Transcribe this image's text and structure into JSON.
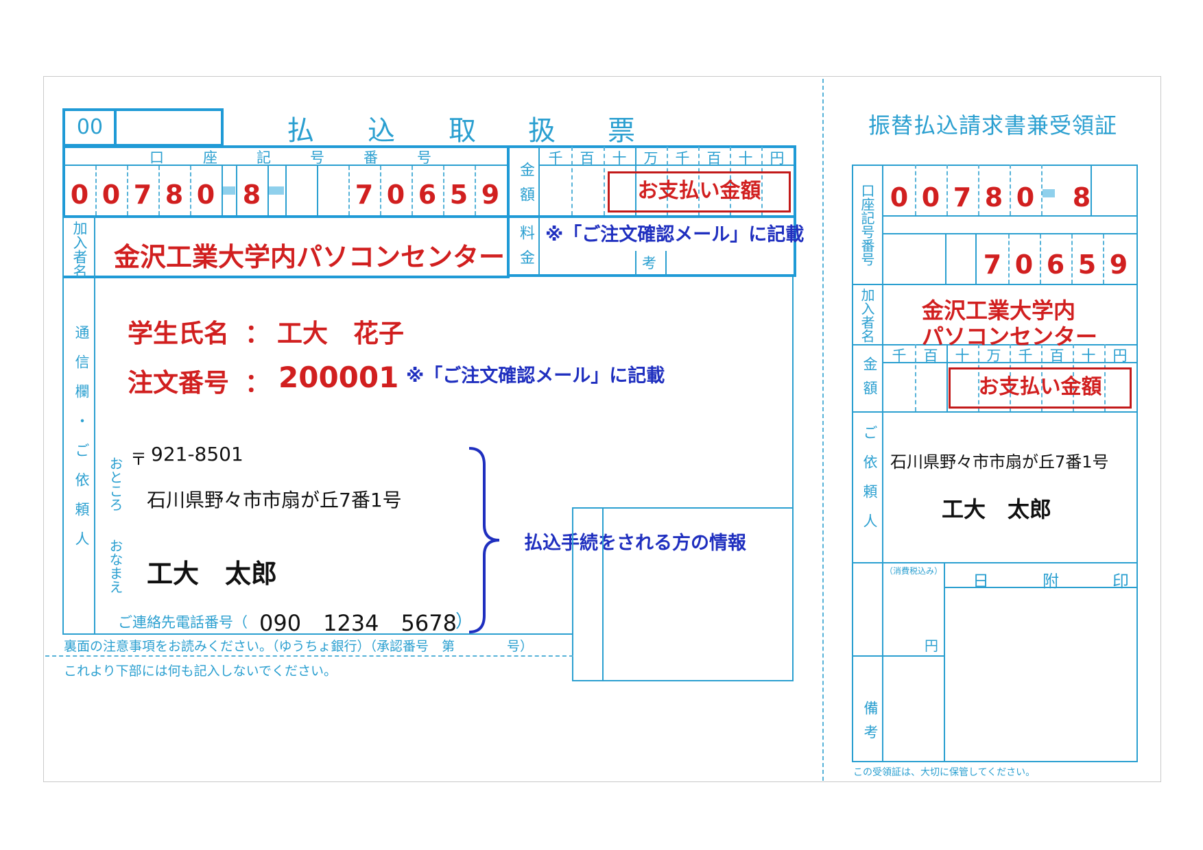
{
  "colors": {
    "line": "#2a9fd0",
    "red": "#d11f1f",
    "navy": "#1f2fbf"
  },
  "main": {
    "code": "00",
    "title": [
      "払",
      "込",
      "取",
      "扱",
      "票"
    ],
    "account_header": [
      "口",
      "座",
      "記",
      "号",
      "番",
      "号"
    ],
    "account_digits_a": [
      "0",
      "0",
      "7",
      "8",
      "0"
    ],
    "account_digit_b": "8",
    "account_digits_c": [
      "7",
      "0",
      "6",
      "5",
      "9"
    ],
    "amount_label": "金額",
    "amount_units": [
      "千",
      "百",
      "十",
      "万",
      "千",
      "百",
      "十",
      "円"
    ],
    "amount_box": "お支払い金額",
    "fee_label": "料金",
    "fee_note": "※「ご注文確認メール」に記載",
    "remarks_label": "考",
    "subscriber_label": "加入者名",
    "subscriber_name": "金沢工業大学内パソコンセンター",
    "comm_label": "通信欄・ご依頼人",
    "student_name_label": "学生氏名",
    "student_name_value": "工大　花子",
    "order_no_label": "注文番号",
    "order_no_value": "200001",
    "colon": "：",
    "order_note": "※「ご注文確認メール」に記載",
    "address_label": "おところ",
    "postal_mark": "〒",
    "postal_code": "921-8501",
    "address": "石川県野々市市扇が丘7番1号",
    "name_label": "おなまえ",
    "name": "工大　太郎",
    "phone_label": "ご連絡先電話番号（",
    "phone": "090　1234　5678",
    "phone_close": "）",
    "payer_info_note": "払込手続をされる方の情報",
    "bottom_note1": "裏面の注意事項をお読みください。（ゆうちょ銀行）（承認番号　第　　　　号）",
    "bottom_note2": "これより下部には何も記入しないでください。"
  },
  "receipt": {
    "title": "振替払込請求書兼受領証",
    "account_label": "口座記号番号",
    "account_digits_a": [
      "0",
      "0",
      "7",
      "8",
      "0"
    ],
    "account_digit_b": "8",
    "account_digits_c": [
      "7",
      "0",
      "6",
      "5",
      "9"
    ],
    "subscriber_label": "加入者名",
    "subscriber_line1": "金沢工業大学内",
    "subscriber_line2": "パソコンセンター",
    "amount_label": "金額",
    "amount_units": [
      "千",
      "百",
      "十",
      "万",
      "千",
      "百",
      "十",
      "円"
    ],
    "amount_box": "お支払い金額",
    "requester_label": "ご依頼人",
    "address": "石川県野々市市扇が丘7番1号",
    "name": "工大　太郎",
    "fee_tax_label": "（消費税込み）",
    "yen": "円",
    "date_stamp": [
      "日",
      "附",
      "印"
    ],
    "remarks_label": "備考",
    "keep_note": "この受領証は、大切に保管してください。"
  }
}
